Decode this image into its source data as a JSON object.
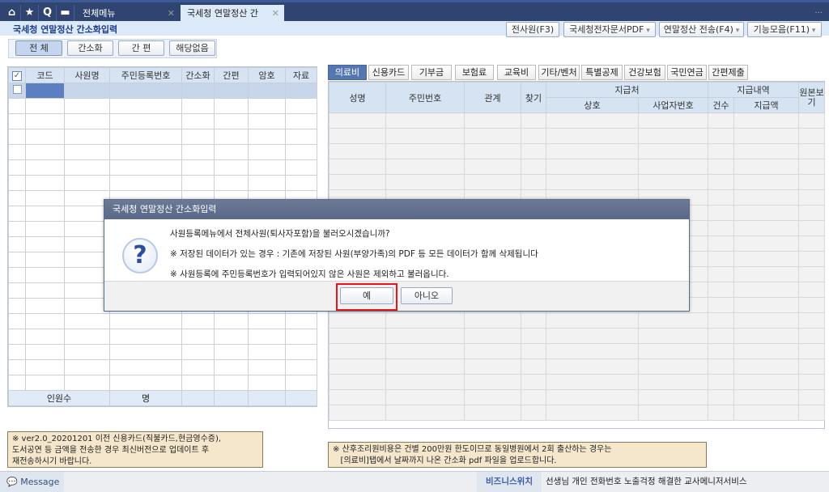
{
  "topbar": {
    "icons": [
      "home-icon",
      "star-icon",
      "search-icon",
      "calendar-icon"
    ],
    "tabs": [
      {
        "label": "전체메뉴"
      },
      {
        "label": "국세청 연말정산 간"
      }
    ],
    "more": "..."
  },
  "page": {
    "title": "국세청 연말정산 간소화입력"
  },
  "toolbar": {
    "all_employees": "전사원(F3)",
    "nts_pdf": "국세청전자문서PDF",
    "send": "연말정산 전송(F4)",
    "functions": "기능모음(F11)"
  },
  "filters": [
    "전 체",
    "간소화",
    "간 편",
    "해당없음"
  ],
  "left_grid": {
    "columns": [
      "코드",
      "사원명",
      "주민등록번호",
      "간소화",
      "간편",
      "암호",
      "자료"
    ],
    "footer": {
      "count_label": "인원수",
      "unit": "명"
    }
  },
  "right_tabs": [
    "의료비",
    "신용카드",
    "기부금",
    "보험료",
    "교육비",
    "기타/벤처",
    "특별공제",
    "건강보험",
    "국민연금",
    "간편제출"
  ],
  "right_grid": {
    "columns": [
      "성명",
      "주민번호",
      "관계",
      "찾기"
    ],
    "group1": "지급처",
    "group1_cols": [
      "상호",
      "사업자번호"
    ],
    "group2": "지급내역",
    "group2_cols": [
      "건수",
      "지급액"
    ],
    "last": "원본보기"
  },
  "notes": {
    "left": [
      "※  ver2.0_20201201 이전 신용카드(직불카드,현금영수증),",
      "도서공연 등 금액을 전송한 경우 최신버전으로 업데이트 후",
      "재전송하시기 바랍니다."
    ],
    "right": [
      "※ 산후조리원비용은 건별 200만원 한도이므로 동일병원에서 2회 출산하는 경우는",
      "   [의료비]탭에서 날짜까지 나온 간소화 pdf 파일을 업로드합니다."
    ]
  },
  "status": {
    "message": "Message",
    "biz_label": "비즈니스위치",
    "biz_text": "선생님 개인 전화번호 노출걱정 해결한 교사메니저서비스"
  },
  "dialog": {
    "title": "국세청 연말정산 간소화입력",
    "lines": [
      "사원등록메뉴에서 전체사원(퇴사자포함)을 불러오시겠습니까?",
      "※ 저장된 데이터가 있는 경우 : 기존에 저장된 사원(부양가족)의 PDF 등 모든 데이터가 함께 삭제됩니다",
      "※ 사원등록에 주민등록번호가 입력되어있지 않은 사원은 제외하고 불러옵니다."
    ],
    "yes": "예",
    "no": "아니오",
    "highlight_color": "#e8141b"
  }
}
